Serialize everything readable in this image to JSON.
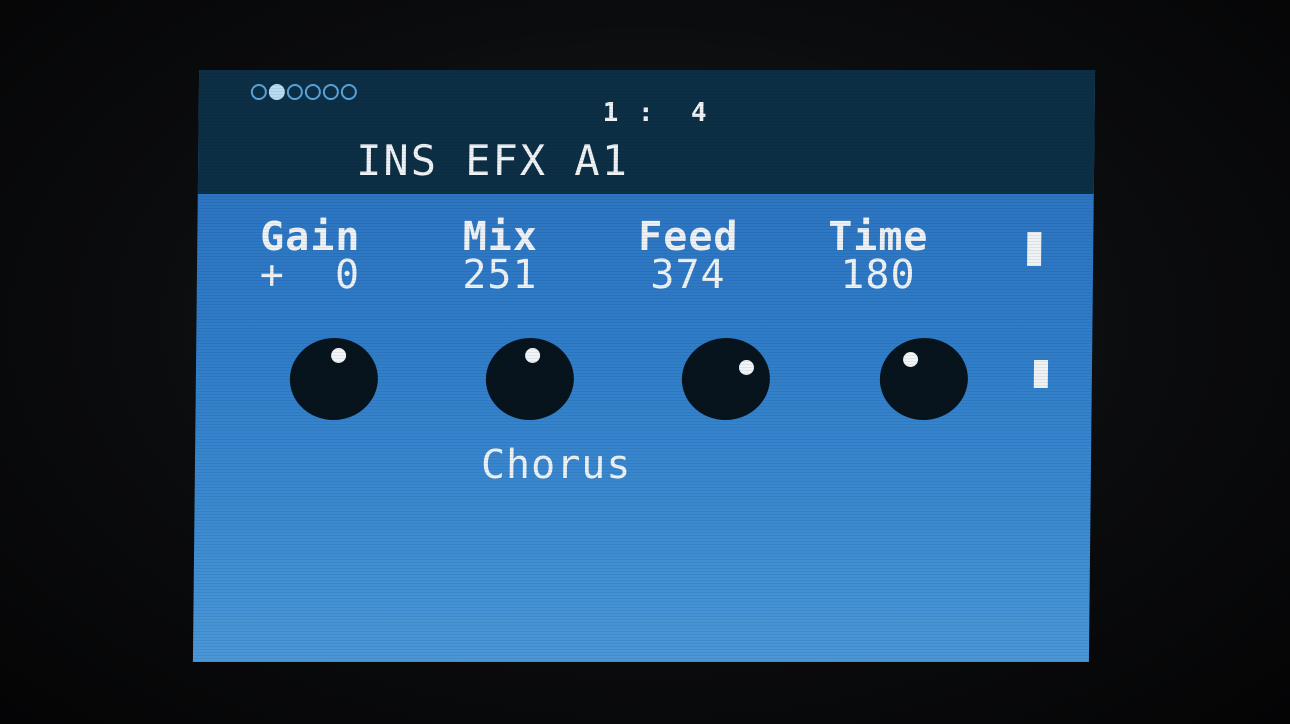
{
  "header": {
    "page_dots": [
      {
        "active": false
      },
      {
        "active": true
      },
      {
        "active": false
      },
      {
        "active": false
      },
      {
        "active": false
      },
      {
        "active": false
      }
    ],
    "position": "1 :  4",
    "title": "INS EFX A1"
  },
  "params": [
    {
      "name": "Gain",
      "value": "+  0"
    },
    {
      "name": "Mix",
      "value": "251"
    },
    {
      "name": "Feed",
      "value": "374"
    },
    {
      "name": "Time",
      "value": "180"
    }
  ],
  "knobs": [
    {
      "param": "Gain",
      "indicator_angle_deg": 10
    },
    {
      "param": "Mix",
      "indicator_angle_deg": 5
    },
    {
      "param": "Feed",
      "indicator_angle_deg": 60
    },
    {
      "param": "Time",
      "indicator_angle_deg": -35
    }
  ],
  "effect_type": "Chorus",
  "colors": {
    "screen_blue": "#2f7cc8",
    "header_dark": "#0d2f46",
    "text": "#eef2f5",
    "knob": "#07141d"
  }
}
